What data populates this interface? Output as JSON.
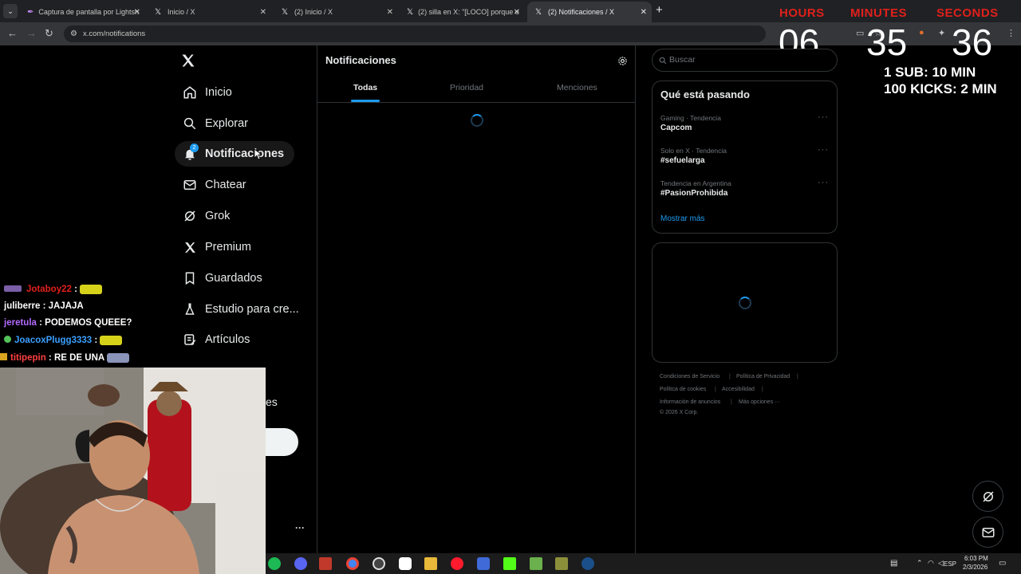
{
  "browser": {
    "tabs": [
      {
        "title": "Captura de pantalla por Lightsh"
      },
      {
        "title": "Inicio / X"
      },
      {
        "title": "(2) Inicio / X"
      },
      {
        "title": "(2) silla en X: \"[LOCO] porque e"
      },
      {
        "title": "(2) Notificaciones / X",
        "active": true
      }
    ],
    "url": "x.com/notifications"
  },
  "overlay": {
    "hours_label": "HOURS",
    "minutes_label": "MINUTES",
    "seconds_label": "SECONDS",
    "hours": "06",
    "minutes": "35",
    "seconds": "36",
    "rule1": "1 SUB: 10 MIN",
    "rule2": "100 KICKS: 2 MIN"
  },
  "sidebar": {
    "items": [
      {
        "label": "Inicio",
        "icon": "home-icon"
      },
      {
        "label": "Explorar",
        "icon": "search-icon"
      },
      {
        "label": "Notificaciones",
        "icon": "bell-icon",
        "badge": "2"
      },
      {
        "label": "Chatear",
        "icon": "mail-icon"
      },
      {
        "label": "Grok",
        "icon": "grok-icon"
      },
      {
        "label": "Premium",
        "icon": "x-logo-icon"
      },
      {
        "label": "Guardados",
        "icon": "bookmark-icon"
      },
      {
        "label": "Estudio para cre...",
        "icon": "flask-icon"
      },
      {
        "label": "Artículos",
        "icon": "article-icon"
      }
    ],
    "partial_label": "es",
    "more": "···"
  },
  "center": {
    "title": "Notificaciones",
    "tabs": [
      "Todas",
      "Prioridad",
      "Menciones"
    ]
  },
  "right": {
    "search_placeholder": "Buscar",
    "trends_title": "Qué está pasando",
    "trends": [
      {
        "meta": "Gaming · Tendencia",
        "name": "Capcom"
      },
      {
        "meta": "Solo en X · Tendencia",
        "name": "#sefuelarga"
      },
      {
        "meta": "Tendencia en Argentina",
        "name": "#PasionProhibida"
      }
    ],
    "show_more": "Mostrar más",
    "footer": [
      "Condiciones de Servicio",
      "Política de Privacidad",
      "Política de cookies",
      "Accesibilidad",
      "Información de anuncios",
      "Más opciones ···",
      "© 2026 X Corp."
    ]
  },
  "chat": [
    {
      "user": "Jotaboy22",
      "msg": ":",
      "color": "#e0201b"
    },
    {
      "user": "juliberre",
      "msg": ": JAJAJA",
      "color": "#ffffff"
    },
    {
      "user": "jeretula",
      "msg": ": PODEMOS QUEEE?",
      "color": "#b36bff"
    },
    {
      "user": "JoacoxPlugg3333",
      "msg": ":",
      "color": "#3aa0ff"
    },
    {
      "user": "titipepin",
      "msg": ": RE DE UNA",
      "color": "#ff4040"
    }
  ],
  "taskbar": {
    "time": "6:03 PM",
    "date": "2/3/2026",
    "lang": "ESP"
  },
  "colors": {
    "accent": "#1d9bf0",
    "timer_red": "#e0201b"
  }
}
